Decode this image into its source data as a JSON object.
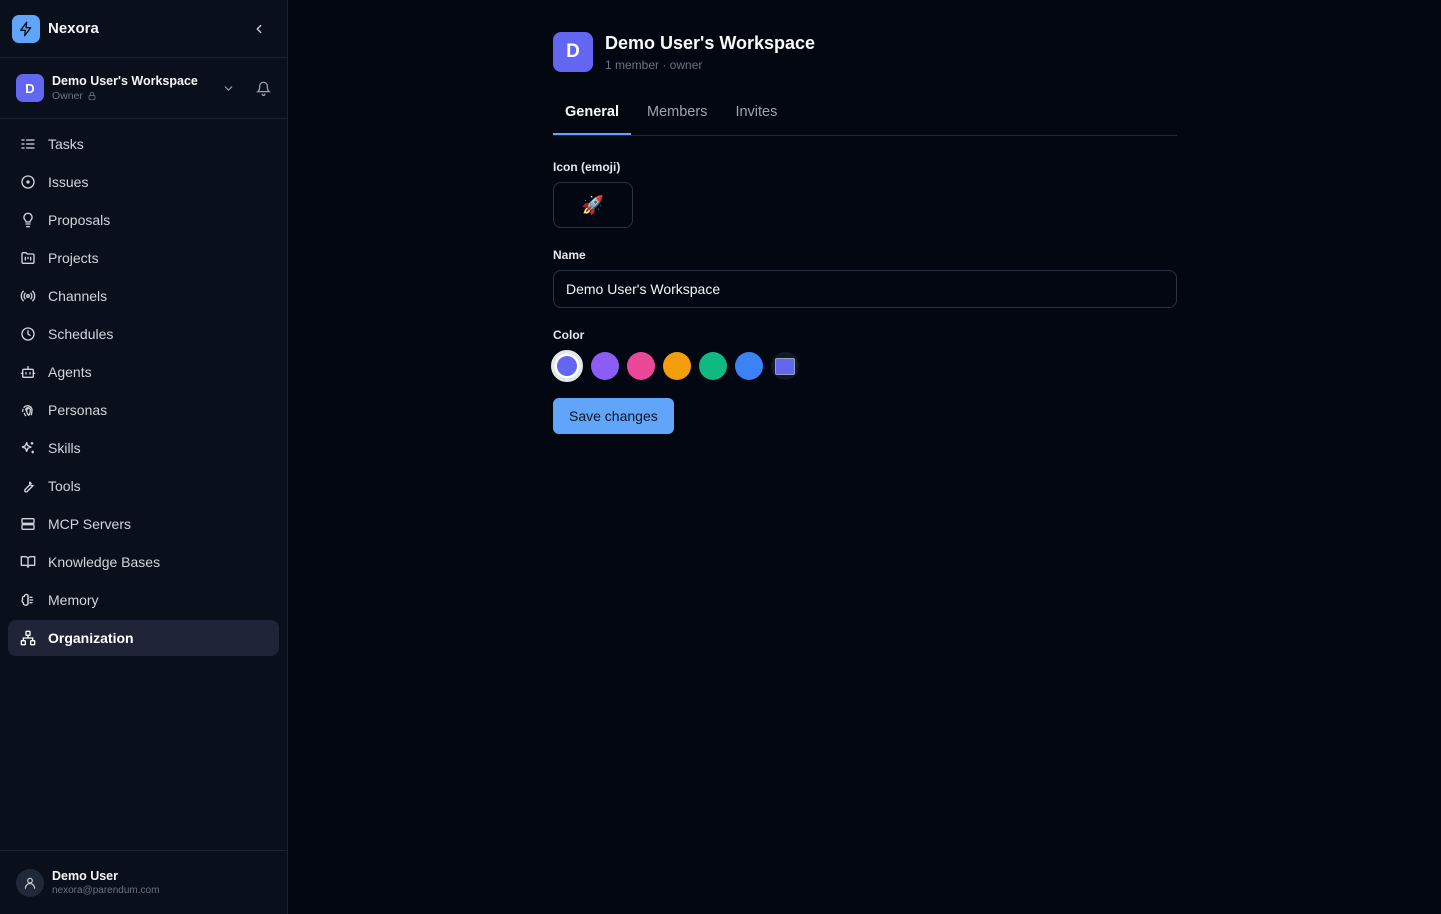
{
  "app": {
    "name": "Nexora"
  },
  "workspace": {
    "avatar_letter": "D",
    "name": "Demo User's Workspace",
    "role": "Owner"
  },
  "nav": {
    "items": [
      {
        "label": "Tasks",
        "icon": "tasks-icon"
      },
      {
        "label": "Issues",
        "icon": "issues-icon"
      },
      {
        "label": "Proposals",
        "icon": "lightbulb-icon"
      },
      {
        "label": "Projects",
        "icon": "projects-icon"
      },
      {
        "label": "Channels",
        "icon": "broadcast-icon"
      },
      {
        "label": "Schedules",
        "icon": "clock-icon"
      },
      {
        "label": "Agents",
        "icon": "bot-icon"
      },
      {
        "label": "Personas",
        "icon": "fingerprint-icon"
      },
      {
        "label": "Skills",
        "icon": "sparkles-icon"
      },
      {
        "label": "Tools",
        "icon": "wrench-icon"
      },
      {
        "label": "MCP Servers",
        "icon": "server-icon"
      },
      {
        "label": "Knowledge Bases",
        "icon": "book-icon"
      },
      {
        "label": "Memory",
        "icon": "brain-icon"
      },
      {
        "label": "Organization",
        "icon": "org-chart-icon",
        "active": true
      }
    ]
  },
  "user": {
    "name": "Demo User",
    "email": "nexora@parendum.com"
  },
  "page": {
    "avatar_letter": "D",
    "title": "Demo User's Workspace",
    "subtitle": "1 member · owner",
    "tabs": [
      {
        "label": "General",
        "active": true
      },
      {
        "label": "Members",
        "active": false
      },
      {
        "label": "Invites",
        "active": false
      }
    ],
    "icon_label": "Icon (emoji)",
    "icon_value": "🚀",
    "name_label": "Name",
    "name_value": "Demo User's Workspace",
    "color_label": "Color",
    "colors": [
      "#6366f1",
      "#8b5cf6",
      "#ec4899",
      "#f59e0b",
      "#10b981",
      "#3b82f6"
    ],
    "selected_color": "#6366f1",
    "save_label": "Save changes"
  },
  "colors": {
    "accent": "#60a5fa",
    "background": "#030712",
    "sidebar": "#0a0f1c"
  }
}
